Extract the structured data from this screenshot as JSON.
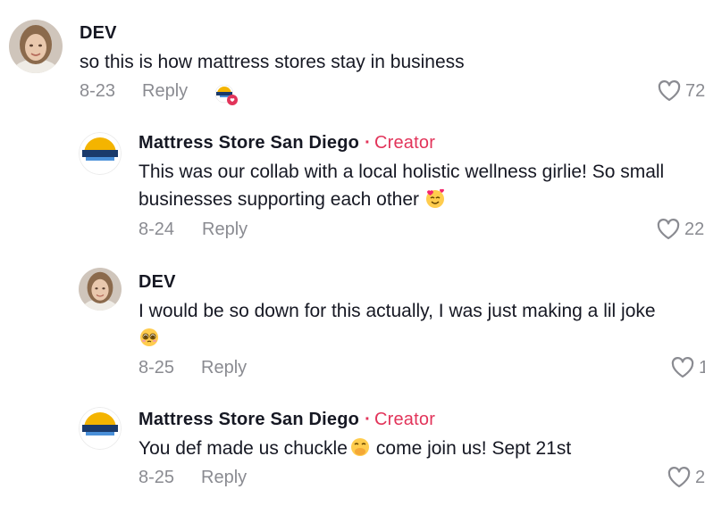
{
  "comments": [
    {
      "author": "DEV",
      "text": "so this is how mattress stores stay in business",
      "date": "8-23",
      "reply_label": "Reply",
      "likes": "72"
    },
    {
      "author": "Mattress Store San Diego",
      "badge": "Creator",
      "text_line1": "This was our collab with a local holistic wellness girlie! So small",
      "text_line2": "businesses supporting each other",
      "date": "8-24",
      "reply_label": "Reply",
      "likes": "22"
    },
    {
      "author": "DEV",
      "text": "I would be so down for this actually, I was just making a lil joke",
      "date": "8-25",
      "reply_label": "Reply",
      "likes": "1"
    },
    {
      "author": "Mattress Store San Diego",
      "badge": "Creator",
      "text_part1": "You def made us chuckle",
      "text_part2": "come join us! Sept 21st",
      "date": "8-25",
      "reply_label": "Reply",
      "likes": "2"
    }
  ],
  "colors": {
    "creator": "#e2345a",
    "muted": "#8a8b91",
    "text": "#161823"
  },
  "icons": {
    "like": "heart-outline-icon",
    "creator_liked": "creator-liked-avatar-icon",
    "emoji_smile_hearts": "smiling-face-with-hearts-emoji",
    "emoji_pleading": "pleading-face-emoji",
    "emoji_giggle": "face-with-hand-over-mouth-emoji"
  }
}
